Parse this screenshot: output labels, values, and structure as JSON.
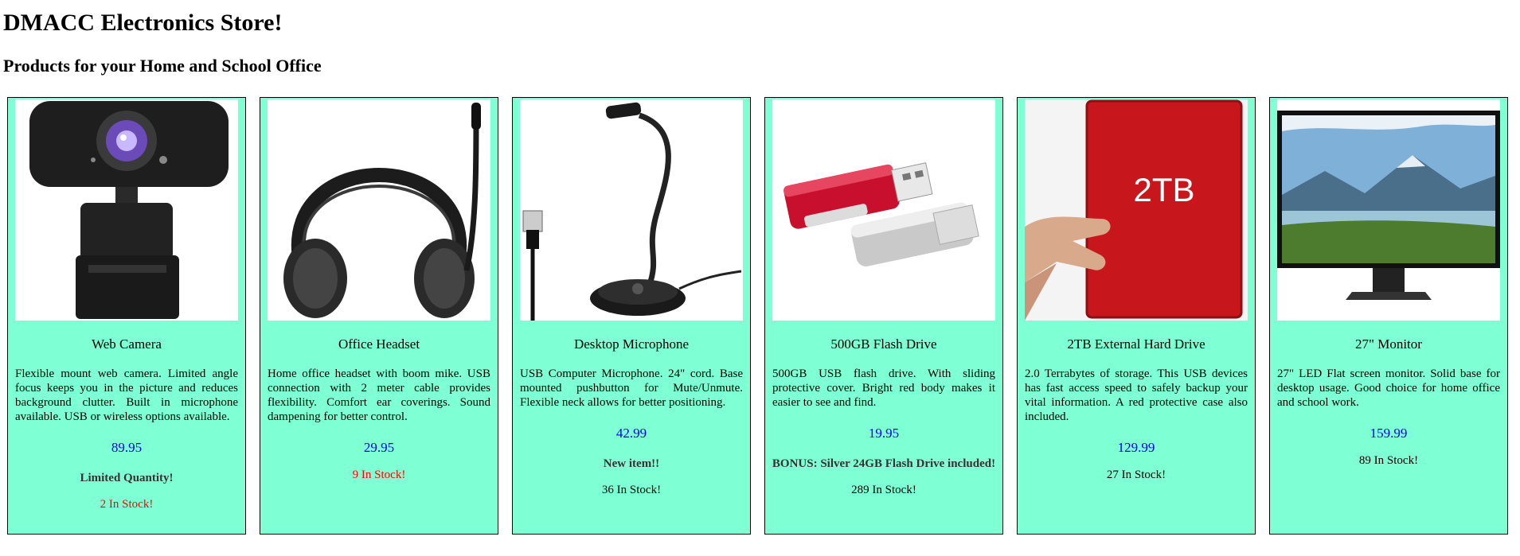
{
  "page": {
    "title": "DMACC Electronics Store!",
    "subtitle": "Products for your Home and School Office"
  },
  "colors": {
    "card_background": "#7fffd4",
    "price": "#0000ee",
    "low_stock": "#ff0000"
  },
  "products": [
    {
      "name": "Web Camera",
      "image_icon": "webcam-icon",
      "description": "Flexible mount web camera. Limited angle focus keeps you in the picture and reduces background clutter. Built in microphone available. USB or wireless options available.",
      "price": "89.95",
      "note": "Limited Quantity!",
      "stock": "2 In Stock!",
      "stock_low": true
    },
    {
      "name": "Office Headset",
      "image_icon": "headset-icon",
      "description": "Home office headset with boom mike. USB connection with 2 meter cable provides flexibility. Comfort ear coverings. Sound dampening for better control.",
      "price": "29.95",
      "note": "",
      "stock": "9 In Stock!",
      "stock_low": true
    },
    {
      "name": "Desktop Microphone",
      "image_icon": "microphone-icon",
      "description": "USB Computer Microphone. 24\" cord. Base mounted pushbutton for Mute/Unmute. Flexible neck allows for better positioning.",
      "price": "42.99",
      "note": "New item!!",
      "stock": "36 In Stock!",
      "stock_low": false
    },
    {
      "name": "500GB Flash Drive",
      "image_icon": "flash-drive-icon",
      "description": "500GB USB flash drive. With sliding protective cover. Bright red body makes it easier to see and find.",
      "price": "19.95",
      "note": "BONUS: Silver 24GB Flash Drive included!",
      "stock": "289 In Stock!",
      "stock_low": false
    },
    {
      "name": "2TB External Hard Drive",
      "image_icon": "hard-drive-icon",
      "image_text": "2TB",
      "description": "2.0 Terrabytes of storage. This USB devices has fast access speed to safely backup your vital information. A red protective case also included.",
      "price": "129.99",
      "note": "",
      "stock": "27 In Stock!",
      "stock_low": false
    },
    {
      "name": "27\" Monitor",
      "image_icon": "monitor-icon",
      "description": "27\" LED Flat screen monitor. Solid base for desktop usage. Good choice for home office and school work.",
      "price": "159.99",
      "note": "",
      "stock": "89 In Stock!",
      "stock_low": false
    }
  ]
}
